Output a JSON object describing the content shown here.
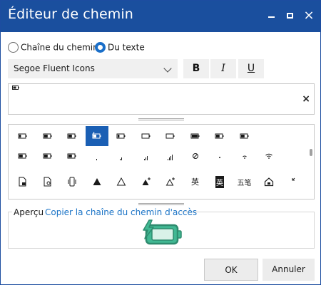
{
  "window": {
    "title": "Éditeur de chemin"
  },
  "titlebar": {
    "close_glyph": "×"
  },
  "mode": {
    "options": [
      {
        "label": "Chaîne du chemin",
        "checked": false
      },
      {
        "label": "Du texte",
        "checked": true
      }
    ]
  },
  "font": {
    "selected": "Segoe Fluent Icons"
  },
  "style_buttons": {
    "bold": "B",
    "italic": "I",
    "underline": "U"
  },
  "path_input": {
    "clear": "×"
  },
  "icon_grid": {
    "selected_index": 3,
    "rows": [
      [
        "battery-low-icon",
        "battery-mid-icon",
        "battery-mid-icon",
        "battery-charging-icon",
        "battery-low-icon",
        "battery-outline-icon",
        "battery-outline-icon",
        "battery-full-icon",
        "battery-mid-icon",
        "battery-mid-icon"
      ],
      [
        "battery-mid-icon",
        "battery-mid-icon",
        "battery-mid-icon",
        "signal-1-icon",
        "signal-2-icon",
        "signal-3-icon",
        "signal-4-icon",
        "no-signal-icon",
        "wifi-1-icon",
        "wifi-2-icon",
        "wifi-3-icon"
      ],
      [
        "document-lock-icon",
        "document-search-icon",
        "phone-vibrate-icon",
        "triangle-filled-icon",
        "triangle-outline-icon",
        "triangle-filled-plus-icon",
        "triangle-outline-plus-icon",
        "ime-ying-icon",
        "ime-ying-boxed-icon",
        "ime-wubi-icon",
        "home-lock-icon",
        "arrow-corner-icon"
      ]
    ],
    "text_glyphs": {
      "ime_ying": "英",
      "ime_ying_boxed": "英",
      "ime_wubi": "五笔"
    }
  },
  "preview": {
    "label": "Aperçu",
    "link": "Copier la chaîne du chemin d'accès",
    "accent": "#2e8b6e",
    "fill": "#41b893"
  },
  "buttons": {
    "ok": "OK",
    "cancel": "Annuler"
  }
}
